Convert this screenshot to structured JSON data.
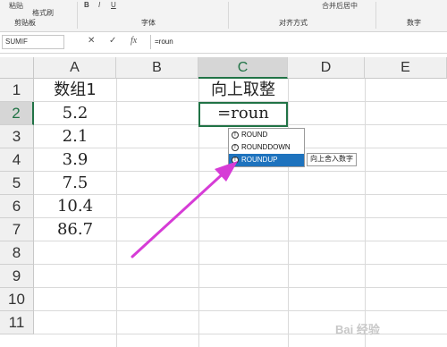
{
  "ribbon": {
    "paste_label": "粘贴",
    "format_painter_label": "格式刷",
    "clipboard_group": "剪贴板",
    "font_group": "字体",
    "alignment_group": "对齐方式",
    "number_group": "数字",
    "merge_center_label": "合并后居中",
    "bold_label": "B",
    "italic_label": "I",
    "underline_label": "U"
  },
  "formula_bar": {
    "name_box": "SUMIF",
    "cancel_glyph": "✕",
    "enter_glyph": "✓",
    "fx_label": "fx",
    "formula": "=roun"
  },
  "columns": [
    "A",
    "B",
    "C",
    "D",
    "E"
  ],
  "rows": [
    "1",
    "2",
    "3",
    "4",
    "5",
    "6",
    "7",
    "8",
    "9",
    "10",
    "11"
  ],
  "cells": {
    "a1": "数组1",
    "a2": "5.2",
    "a3": "2.1",
    "a4": "3.9",
    "a5": "7.5",
    "a6": "10.4",
    "a7": "86.7",
    "c1": "向上取整",
    "c2": "=roun"
  },
  "autocomplete": {
    "items": [
      "ROUND",
      "ROUNDDOWN",
      "ROUNDUP"
    ],
    "selected": "ROUNDUP",
    "tooltip": "向上舍入数字"
  },
  "watermark": "Bai 经验",
  "colors": {
    "accent_green": "#217346",
    "selection_blue": "#1e73be",
    "arrow_magenta": "#d63cd6"
  }
}
